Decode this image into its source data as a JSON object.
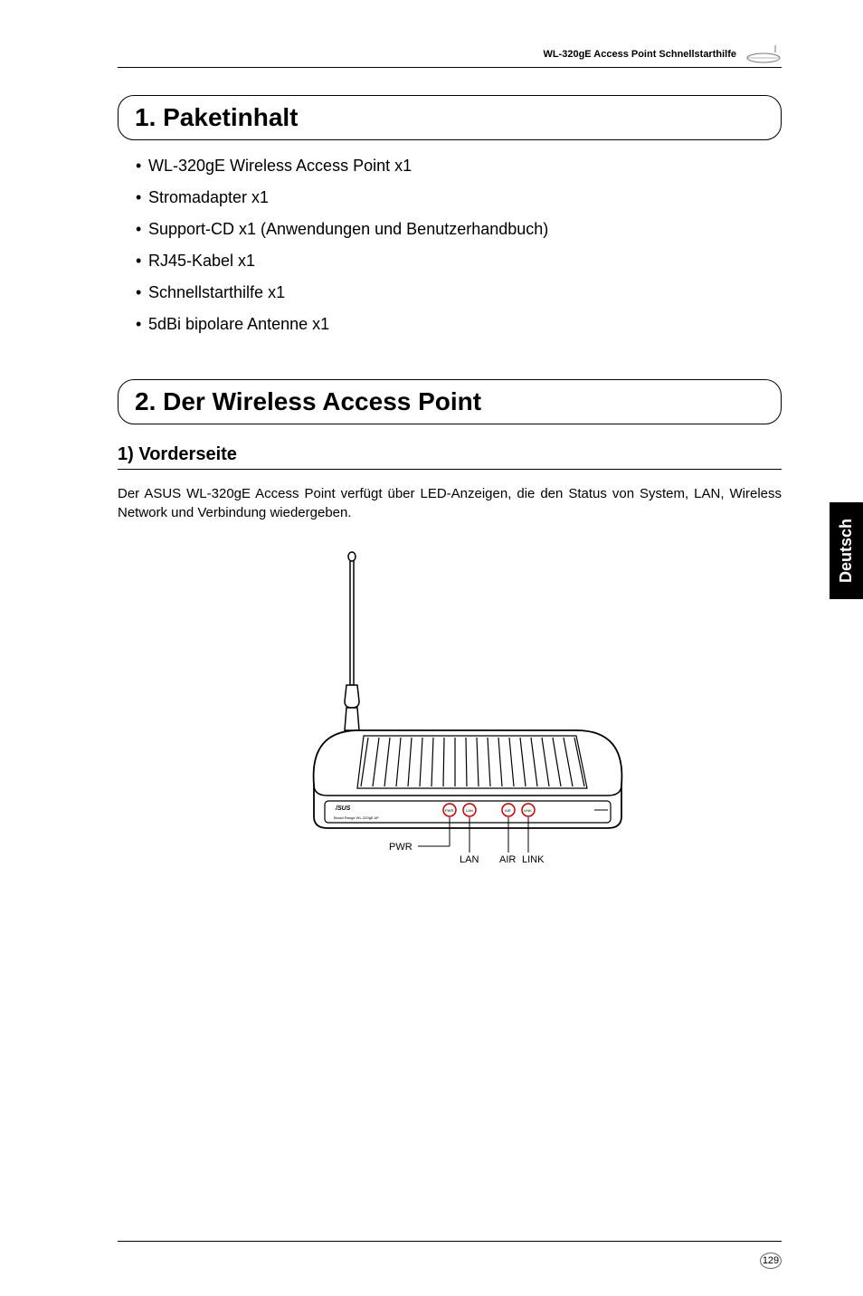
{
  "header": {
    "text": "WL-320gE Access Point Schnellstarthilfe"
  },
  "section1": {
    "title": "1. Paketinhalt",
    "items": [
      "WL-320gE Wireless Access Point x1",
      "Stromadapter x1",
      "Support-CD x1 (Anwendungen und Benutzerhandbuch)",
      "RJ45-Kabel x1",
      "Schnellstarthilfe x1",
      "5dBi bipolare Antenne x1"
    ]
  },
  "section2": {
    "title": "2. Der Wireless Access Point",
    "subsection": "1) Vorderseite",
    "body": "Der ASUS WL-320gE Access Point verfügt über LED-Anzeigen, die den Status von System, LAN, Wireless Network und Verbindung wiedergeben."
  },
  "diagram": {
    "labels": {
      "pwr": "PWR",
      "lan": "LAN",
      "air": "AIR",
      "link": "LINK"
    }
  },
  "sideTab": "Deutsch",
  "pageNumber": "129"
}
